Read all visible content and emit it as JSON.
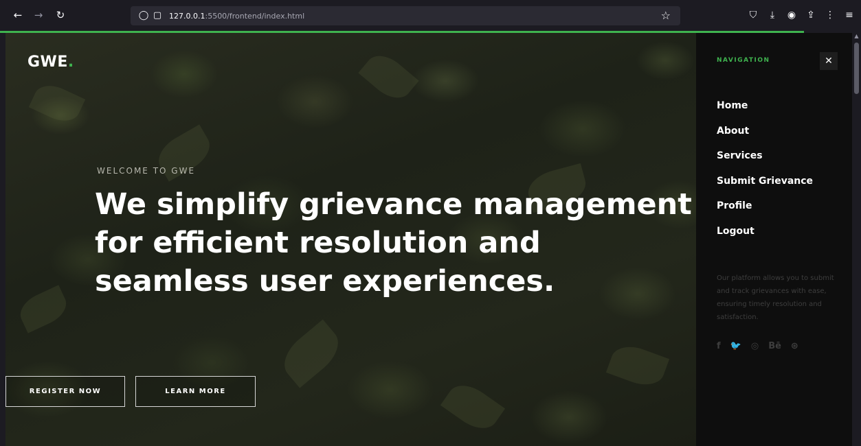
{
  "browser": {
    "url_host": "127.0.0.1",
    "url_rest": ":5500/frontend/index.html"
  },
  "hero": {
    "logo_text": "GWE",
    "logo_dot": ".",
    "eyebrow": "WELCOME TO GWE",
    "headline_lines": [
      "We simplify grievance management",
      "for efficient resolution and",
      "seamless user experiences."
    ],
    "register_label": "REGISTER NOW",
    "learn_label": "LEARN MORE"
  },
  "drawer": {
    "title": "NAVIGATION",
    "close_glyph": "✕",
    "items": [
      "Home",
      "About",
      "Services",
      "Submit Grievance",
      "Profile",
      "Logout"
    ],
    "description": "Our platform allows you to submit and track grievances with ease, ensuring timely resolution and satisfaction.",
    "socials": [
      {
        "name": "facebook-icon",
        "glyph": "f"
      },
      {
        "name": "twitter-icon",
        "glyph": "🐦"
      },
      {
        "name": "instagram-icon",
        "glyph": "◎"
      },
      {
        "name": "behance-icon",
        "glyph": "Bē"
      },
      {
        "name": "dribbble-icon",
        "glyph": "⊛"
      }
    ]
  },
  "colors": {
    "accent": "#3fb34f",
    "drawer_bg": "#0e0e0e",
    "browser_bg": "#1c1b22"
  }
}
